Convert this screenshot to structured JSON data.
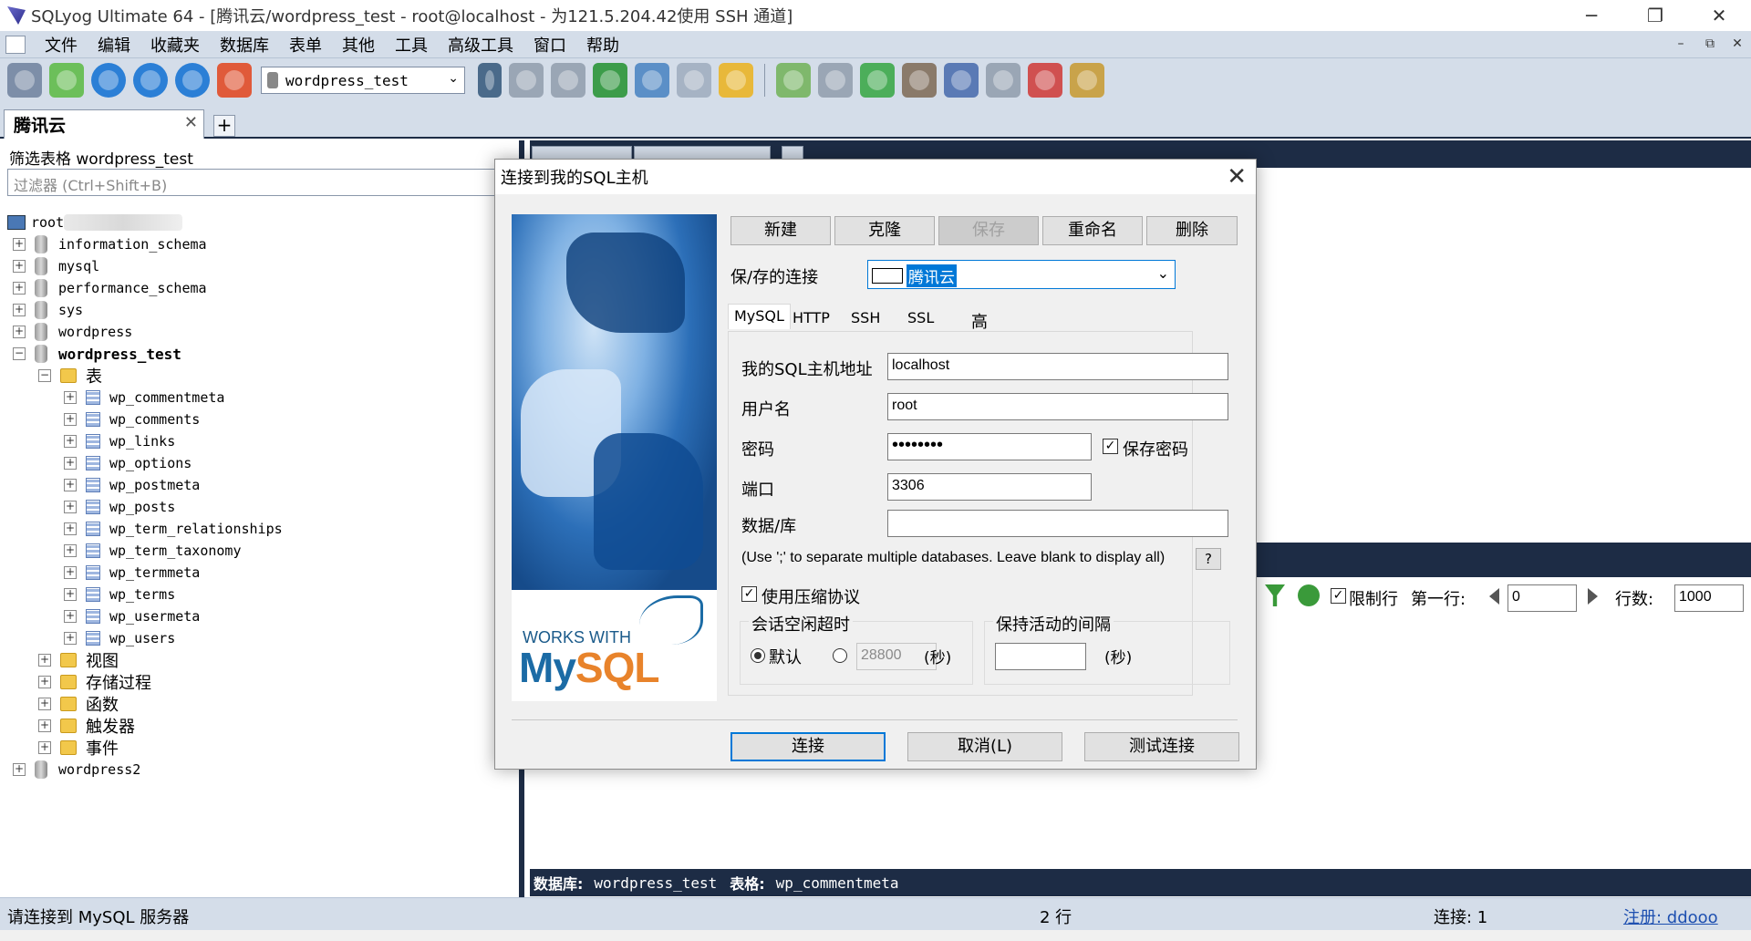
{
  "window": {
    "title": "SQLyog Ultimate 64 - [腾讯云/wordpress_test - root@localhost - 为121.5.204.42使用 SSH 通道]",
    "minimize": "─",
    "restore": "❐",
    "close": "✕"
  },
  "menu": {
    "items": [
      "文件",
      "编辑",
      "收藏夹",
      "数据库",
      "表单",
      "其他",
      "工具",
      "高级工具",
      "窗口",
      "帮助"
    ],
    "mdi_min": "–",
    "mdi_restore": "⧉",
    "mdi_close": "✕"
  },
  "toolbar": {
    "db_selected": "wordpress_test",
    "db_arrow": "⌄"
  },
  "connection_tab": {
    "label": "腾讯云",
    "close": "✕",
    "new_tab": "+"
  },
  "left_panel": {
    "filter_label": "筛选表格 wordpress_test",
    "filter_placeholder": "过滤器 (Ctrl+Shift+B)",
    "root_label": "root",
    "databases": [
      "information_schema",
      "mysql",
      "performance_schema",
      "sys",
      "wordpress"
    ],
    "active_db": "wordpress_test",
    "tables_folder": "表",
    "tables": [
      "wp_commentmeta",
      "wp_comments",
      "wp_links",
      "wp_options",
      "wp_postmeta",
      "wp_posts",
      "wp_term_relationships",
      "wp_term_taxonomy",
      "wp_termmeta",
      "wp_terms",
      "wp_usermeta",
      "wp_users"
    ],
    "folders": [
      "视图",
      "存储过程",
      "函数",
      "触发器",
      "事件"
    ],
    "last_db": "wordpress2",
    "plus": "+",
    "minus": "−"
  },
  "result_toolbar": {
    "limit_label": "限制行",
    "first_row_label": "第一行:",
    "first_row_value": "0",
    "rows_label": "行数:",
    "rows_value": "1000"
  },
  "db_status": {
    "db_label": "数据库:",
    "db_value": "wordpress_test",
    "table_label": "表格:",
    "table_value": "wp_commentmeta"
  },
  "statusbar": {
    "message": "请连接到 MySQL 服务器",
    "rows": "2 行",
    "connections": "连接: 1",
    "register": "注册: ddooo"
  },
  "dialog": {
    "title": "连接到我的SQL主机",
    "close": "✕",
    "buttons": {
      "new": "新建",
      "clone": "克隆",
      "save": "保存",
      "rename": "重命名",
      "delete": "删除"
    },
    "saved_label": "保/存的连接",
    "saved_value": "腾讯云",
    "saved_arrow": "⌄",
    "tabs": [
      "MySQL",
      "HTTP",
      "SSH",
      "SSL",
      "高级功能"
    ],
    "fields": {
      "host_label": "我的SQL主机地址",
      "host_value": "localhost",
      "user_label": "用户名",
      "user_value": "root",
      "password_label": "密码",
      "password_value": "••••••••",
      "save_password_label": "保存密码",
      "port_label": "端口",
      "port_value": "3306",
      "database_label": "数据/库",
      "database_value": ""
    },
    "hint": "(Use ';' to separate multiple databases. Leave blank to display all)",
    "help": "?",
    "compression_label": "使用压缩协议",
    "session_group": "会话空闲超时",
    "default_label": "默认",
    "timeout_value": "28800",
    "seconds": "(秒)",
    "keepalive_group": "保持活动的间隔",
    "keepalive_value": "",
    "checkmark": "✓",
    "footer": {
      "connect": "连接",
      "cancel": "取消(L)",
      "test": "测试连接"
    },
    "logo": {
      "works_with": "WORKS WITH",
      "my": "My",
      "sql": "SQL"
    }
  }
}
